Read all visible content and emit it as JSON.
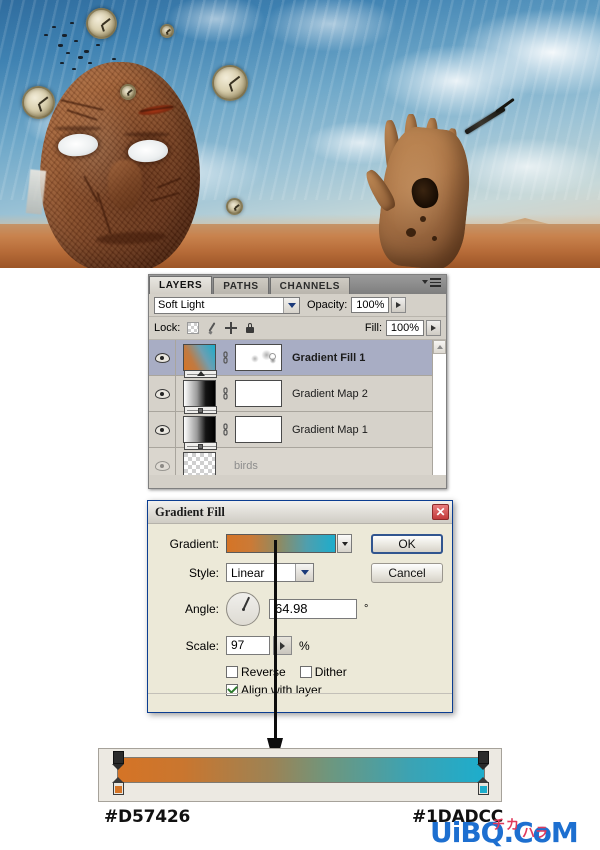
{
  "photo": {
    "alt": "surreal desert composite: cracked clay face, floating pocket watches, birds, raised hand, blue sky"
  },
  "layers_panel": {
    "tabs": [
      {
        "label": "LAYERS",
        "active": true
      },
      {
        "label": "PATHS",
        "active": false
      },
      {
        "label": "CHANNELS",
        "active": false
      }
    ],
    "menu_icon": "panel-menu-icon",
    "blend_mode": "Soft Light",
    "opacity_label": "Opacity:",
    "opacity_value": "100%",
    "lock_label": "Lock:",
    "lock_icons": [
      "lock-transparent-pixels-icon",
      "lock-image-pixels-icon",
      "lock-position-icon",
      "lock-all-icon"
    ],
    "fill_label": "Fill:",
    "fill_value": "100%",
    "layers": [
      {
        "name": "Gradient Fill 1",
        "selected": true,
        "visible": true,
        "thumb": "gradient-fill",
        "has_mask": true,
        "mask": "clouds",
        "linked": true
      },
      {
        "name": "Gradient Map 2",
        "selected": false,
        "visible": true,
        "thumb": "gradient-map",
        "has_mask": true,
        "mask": "white",
        "linked": true
      },
      {
        "name": "Gradient Map 1",
        "selected": false,
        "visible": true,
        "thumb": "gradient-map",
        "has_mask": true,
        "mask": "white",
        "linked": true
      },
      {
        "name": "birds",
        "selected": false,
        "visible": true,
        "thumb": "transparent",
        "has_mask": false,
        "mask": "",
        "linked": false,
        "dimmed": true
      }
    ]
  },
  "gradient_dialog": {
    "title": "Gradient Fill",
    "close_label": "✕",
    "gradient_label": "Gradient:",
    "gradient_preview_from": "#D57426",
    "gradient_preview_to": "#1DADCC",
    "style_label": "Style:",
    "style_value": "Linear",
    "angle_label": "Angle:",
    "angle_value": "64.98",
    "angle_unit": "°",
    "scale_label": "Scale:",
    "scale_value": "97",
    "scale_unit": "%",
    "reverse_label": "Reverse",
    "reverse_checked": false,
    "dither_label": "Dither",
    "dither_checked": false,
    "align_label": "Align with layer",
    "align_checked": true,
    "ok_label": "OK",
    "cancel_label": "Cancel"
  },
  "gradient_editor": {
    "left_hex": "#D57426",
    "right_hex": "#1DADCC",
    "stops": [
      {
        "position": 0,
        "color": "#D57426"
      },
      {
        "position": 100,
        "color": "#1DADCC"
      }
    ],
    "opacity_stops": [
      {
        "position": 0,
        "opacity": 100
      },
      {
        "position": 100,
        "opacity": 100
      }
    ]
  },
  "watermark": {
    "text": "UiBQ.CoM",
    "mark1": "チカ",
    "mark2": "ハラ"
  }
}
